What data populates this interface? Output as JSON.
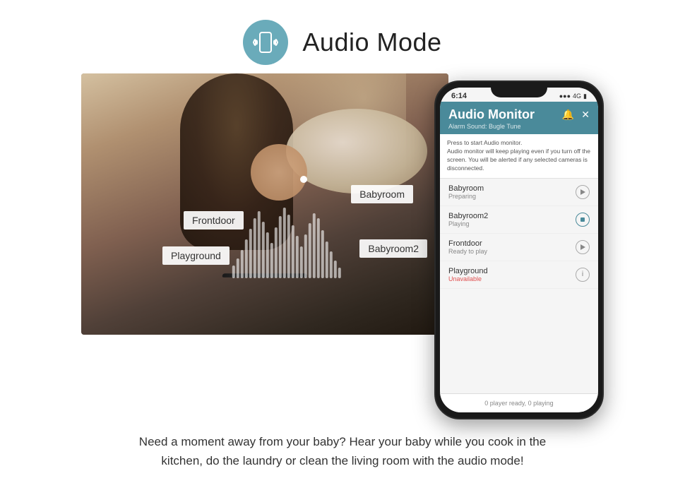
{
  "header": {
    "title": "Audio Mode",
    "icon_name": "audio-mode-icon"
  },
  "photo": {
    "labels": {
      "frontdoor": "Frontdoor",
      "babyroom": "Babyroom",
      "playground": "Playground",
      "babyroom2": "Babyroom2"
    }
  },
  "phone": {
    "status_bar": {
      "time": "6:14",
      "signal": "●●●",
      "network": "4G",
      "battery": "▮"
    },
    "app": {
      "title": "Audio Monitor",
      "alarm_label": "Alarm Sound: Bugle Tune",
      "description": "Press to start Audio monitor.\nAudio monitor will keep playing even if you turn off the screen. You will be alerted if any selected cameras is disconnected.",
      "cameras": [
        {
          "name": "Babyroom",
          "status": "Preparing",
          "action": "play",
          "unavailable": false
        },
        {
          "name": "Babyroom2",
          "status": "Playing",
          "action": "stop",
          "unavailable": false
        },
        {
          "name": "Frontdoor",
          "status": "Ready to play",
          "action": "play",
          "unavailable": false
        },
        {
          "name": "Playground",
          "status": "Unavailable",
          "action": "info",
          "unavailable": true
        }
      ],
      "footer": "0 player ready, 0 playing"
    }
  },
  "bottom_text": {
    "line1": "Need a moment away from your baby? Hear your baby while you cook in the",
    "line2": "kitchen, do the laundry or clean the living room with the audio mode!"
  }
}
